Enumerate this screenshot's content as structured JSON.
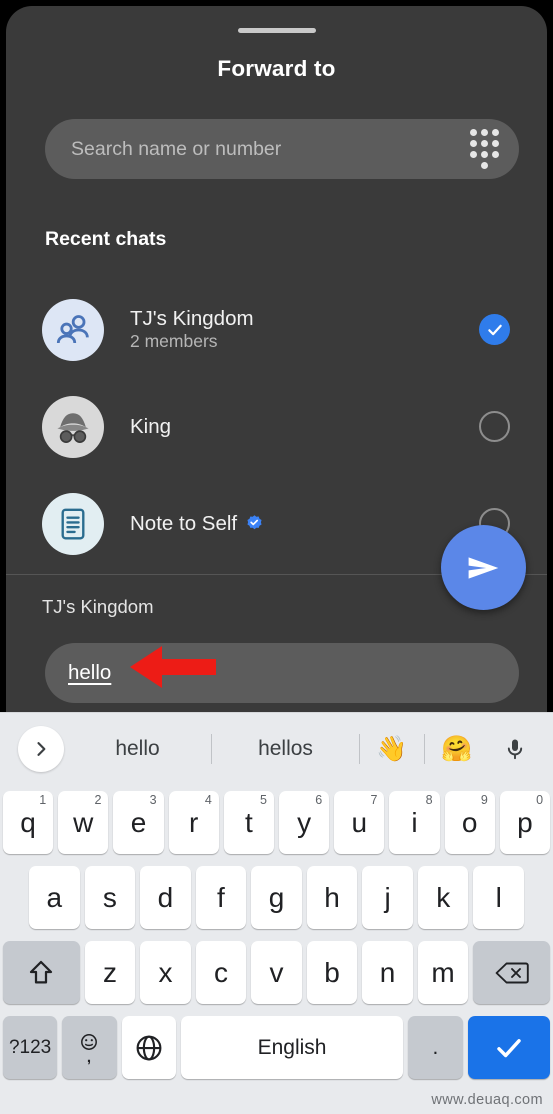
{
  "sheet": {
    "title": "Forward to",
    "grabber": "drag-handle",
    "search": {
      "placeholder": "Search name or number",
      "value": "",
      "trailing_icon": "dialpad-icon"
    },
    "section_title": "Recent chats",
    "chats": [
      {
        "name": "TJ's Kingdom",
        "subtitle": "2 members",
        "avatar_icon": "group-people-icon",
        "verified": false,
        "selected": true
      },
      {
        "name": "King",
        "subtitle": "",
        "avatar_icon": "incognito-face-icon",
        "avatar_glyph": "🕵",
        "verified": false,
        "selected": false
      },
      {
        "name": "Note to Self",
        "subtitle": "",
        "avatar_icon": "note-document-icon",
        "verified": true,
        "selected": false
      }
    ],
    "compose": {
      "target_label": "TJ's Kingdom",
      "message": "hello"
    },
    "send_button": {
      "icon": "send-paper-plane-icon",
      "label": "Send"
    }
  },
  "annotation": {
    "arrow_color": "#ed1c16",
    "points_to": "hello"
  },
  "keyboard": {
    "suggestions": [
      "hello",
      "hellos"
    ],
    "emoji_suggestions": [
      "👋",
      "🤗"
    ],
    "expand_icon": "chevron-right-icon",
    "mic_icon": "microphone-icon",
    "rows": [
      [
        {
          "label": "q",
          "num": "1"
        },
        {
          "label": "w",
          "num": "2"
        },
        {
          "label": "e",
          "num": "3"
        },
        {
          "label": "r",
          "num": "4"
        },
        {
          "label": "t",
          "num": "5"
        },
        {
          "label": "y",
          "num": "6"
        },
        {
          "label": "u",
          "num": "7"
        },
        {
          "label": "i",
          "num": "8"
        },
        {
          "label": "o",
          "num": "9"
        },
        {
          "label": "p",
          "num": "0"
        }
      ],
      [
        {
          "label": "a"
        },
        {
          "label": "s"
        },
        {
          "label": "d"
        },
        {
          "label": "f"
        },
        {
          "label": "g"
        },
        {
          "label": "h"
        },
        {
          "label": "j"
        },
        {
          "label": "k"
        },
        {
          "label": "l"
        }
      ],
      [
        {
          "label": "z"
        },
        {
          "label": "x"
        },
        {
          "label": "c"
        },
        {
          "label": "v"
        },
        {
          "label": "b"
        },
        {
          "label": "n"
        },
        {
          "label": "m"
        }
      ]
    ],
    "shift_icon": "shift-arrow-icon",
    "backspace_icon": "backspace-icon",
    "symbols_key": "?123",
    "emoji_key_icon": "emoji-smiley-icon",
    "emoji_key_sub": ",",
    "globe_key_icon": "globe-language-icon",
    "space_key": "English",
    "period_key": ".",
    "enter_icon": "checkmark-icon"
  },
  "watermark": "www.deuaq.com"
}
